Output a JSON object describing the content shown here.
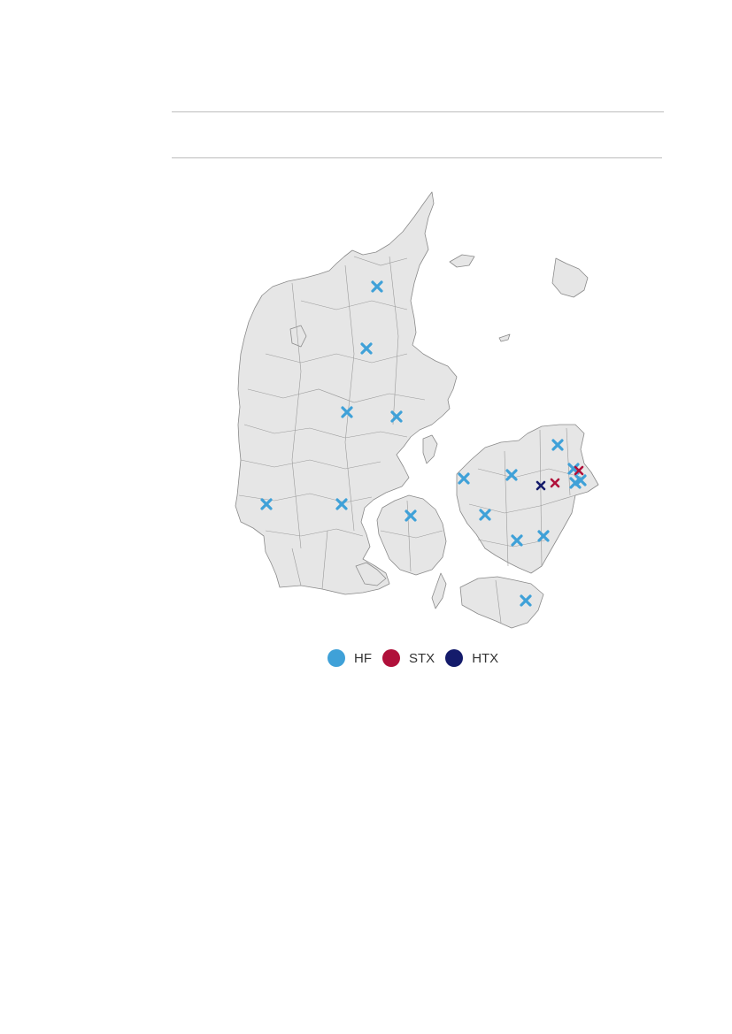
{
  "legend": [
    {
      "key": "hf",
      "label": "HF",
      "color": "#3fa1d8"
    },
    {
      "key": "stx",
      "label": "STX",
      "color": "#b0103a"
    },
    {
      "key": "htx",
      "label": "HTX",
      "color": "#141b6b"
    }
  ],
  "colors": {
    "land": "#e6e6e6",
    "border": "#8a8a8a"
  },
  "markers": [
    {
      "type": "hf"
    },
    {
      "type": "hf"
    },
    {
      "type": "hf"
    },
    {
      "type": "hf"
    },
    {
      "type": "hf"
    },
    {
      "type": "hf"
    },
    {
      "type": "hf"
    },
    {
      "type": "hf"
    },
    {
      "type": "hf"
    },
    {
      "type": "hf"
    },
    {
      "type": "hf"
    },
    {
      "type": "hf"
    },
    {
      "type": "hf"
    },
    {
      "type": "hf"
    },
    {
      "type": "hf"
    },
    {
      "type": "hf"
    },
    {
      "type": "hf"
    },
    {
      "type": "stx"
    },
    {
      "type": "stx"
    },
    {
      "type": "htx"
    }
  ]
}
